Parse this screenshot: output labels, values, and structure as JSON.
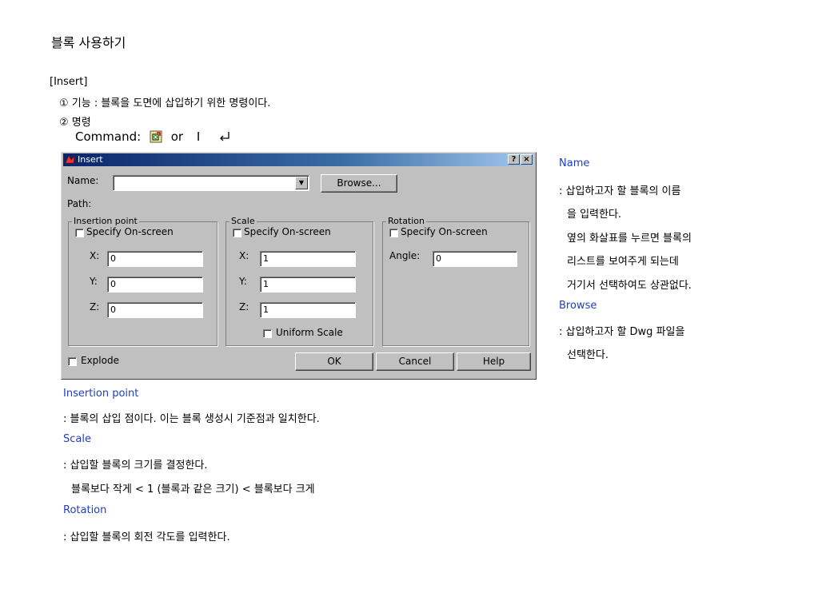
{
  "heading": "블록 사용하기",
  "section": "[Insert]",
  "line1": "① 기능 : 블록을 도면에 삽입하기 위한 명령이다.",
  "line2": "② 명령",
  "command": {
    "label": "Command:",
    "or": "or",
    "key": "I",
    "enter_glyph": "⏎"
  },
  "dialog": {
    "title": "Insert",
    "help_btn": "?",
    "close_btn": "×",
    "name_label": "Name:",
    "name_value": "",
    "browse_btn": "Browse...",
    "path_label": "Path:",
    "insertion_group": "Insertion point",
    "scale_group": "Scale",
    "rotation_group": "Rotation",
    "specify": "Specify On-screen",
    "x_label": "X:",
    "y_label": "Y:",
    "z_label": "Z:",
    "ins_x": "0",
    "ins_y": "0",
    "ins_z": "0",
    "sc_x": "1",
    "sc_y": "1",
    "sc_z": "1",
    "angle_label": "Angle:",
    "angle_value": "0",
    "uniform": "Uniform Scale",
    "explode": "Explode",
    "ok": "OK",
    "cancel": "Cancel",
    "help": "Help"
  },
  "side": {
    "name_title": "Name",
    "name_desc1": ": 삽입하고자 할 블록의 이름",
    "name_desc2": "을 입력한다.",
    "name_desc3": "옆의 화살표를 누르면 블록의",
    "name_desc4": "리스트를 보여주게 되는데",
    "name_desc5": "거기서 선택하여도 상관없다.",
    "browse_title": "Browse",
    "browse_desc1": ": 삽입하고자 할 Dwg 파일을",
    "browse_desc2": "선택한다."
  },
  "below": {
    "ins_title": "Insertion point",
    "ins_desc": ": 블록의 삽입 점이다. 이는 블록 생성시 기준점과 일치한다.",
    "scale_title": "Scale",
    "scale_desc1": ": 삽입할 블록의 크기를 결정한다.",
    "scale_desc2": "블록보다 작게 < 1 (블록과 같은 크기) < 블록보다 크게",
    "rot_title": "Rotation",
    "rot_desc": ": 삽입할 블록의 회전 각도를 입력한다."
  }
}
